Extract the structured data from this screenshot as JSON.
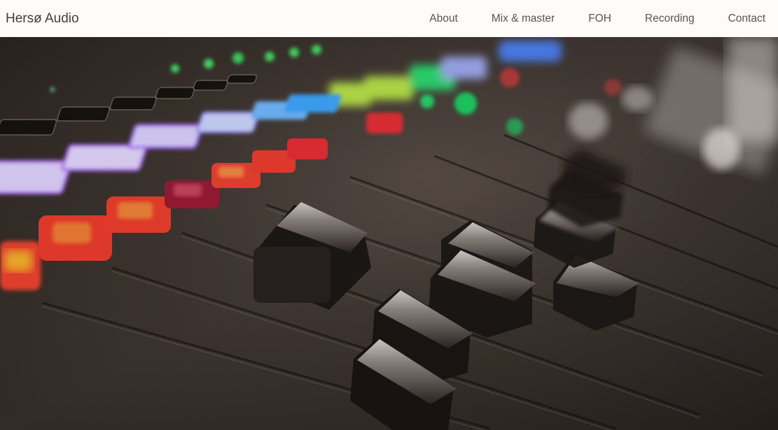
{
  "brand": {
    "name": "Hersø Audio"
  },
  "nav": {
    "items": [
      {
        "label": "About"
      },
      {
        "label": "Mix & master"
      },
      {
        "label": "FOH"
      },
      {
        "label": "Recording"
      },
      {
        "label": "Contact"
      }
    ]
  },
  "hero": {
    "image_subject": "mixing-console-faders"
  },
  "colors": {
    "navbar_bg": "#fefbf9",
    "brand_text": "#3f3f3f",
    "nav_text": "#555555"
  }
}
